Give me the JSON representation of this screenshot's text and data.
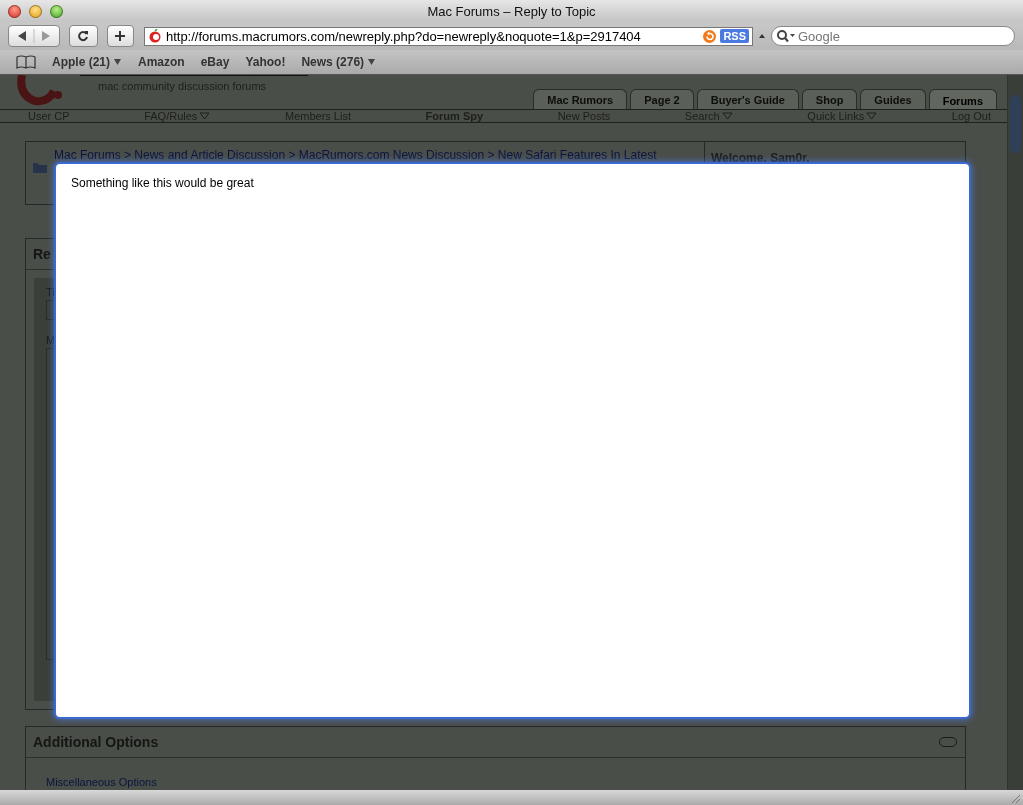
{
  "window": {
    "title": "Mac Forums – Reply to Topic"
  },
  "toolbar": {
    "address": "http://forums.macrumors.com/newreply.php?do=newreply&noquote=1&p=2917404",
    "rss": "RSS",
    "search_placeholder": "Google"
  },
  "bookmarks": [
    {
      "label": "Apple (21)",
      "menu": true
    },
    {
      "label": "Amazon",
      "menu": false
    },
    {
      "label": "eBay",
      "menu": false
    },
    {
      "label": "Yahoo!",
      "menu": false
    },
    {
      "label": "News (276)",
      "menu": true
    }
  ],
  "site": {
    "tagline": "mac community discussion forums",
    "tabs": [
      {
        "label": "Mac Rumors",
        "selected": false
      },
      {
        "label": "Page 2",
        "selected": false
      },
      {
        "label": "Buyer's Guide",
        "selected": false
      },
      {
        "label": "Shop",
        "selected": false
      },
      {
        "label": "Guides",
        "selected": false
      },
      {
        "label": "Forums",
        "selected": true
      }
    ],
    "nav": [
      {
        "label": "User CP",
        "bold": false,
        "menu": false
      },
      {
        "label": "FAQ/Rules",
        "bold": false,
        "menu": true
      },
      {
        "label": "Members List",
        "bold": false,
        "menu": false
      },
      {
        "label": "Forum Spy",
        "bold": true,
        "menu": false
      },
      {
        "label": "New Posts",
        "bold": false,
        "menu": false
      },
      {
        "label": "Search",
        "bold": false,
        "menu": true
      },
      {
        "label": "Quick Links",
        "bold": false,
        "menu": true
      },
      {
        "label": "Log Out",
        "bold": false,
        "menu": false
      }
    ],
    "breadcrumb": "Mac Forums > News and Article Discussion > MacRumors.com News Discussion > New Safari Features In Latest",
    "welcome": "Welcome, Sam0r.",
    "reply_heading": "Re",
    "title_label": "Ti",
    "message_label": "M",
    "additional_options": "Additional Options",
    "misc_legend": "Miscellaneous Options"
  },
  "editor": {
    "value": "Something like this would be great"
  }
}
